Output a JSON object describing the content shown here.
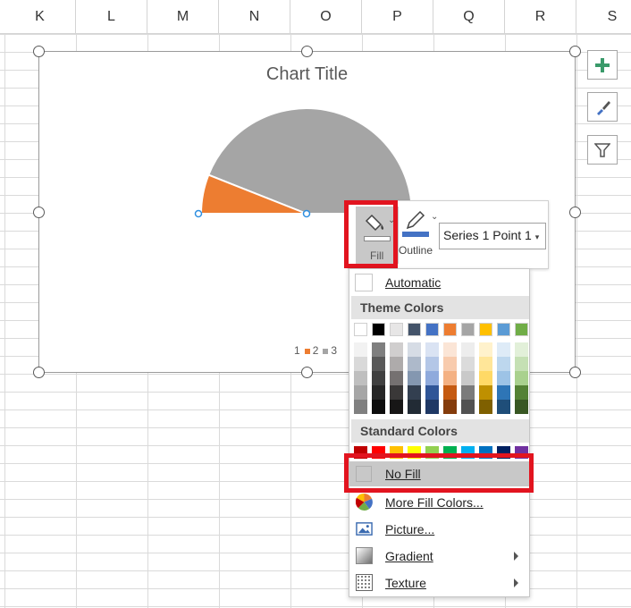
{
  "columns": [
    "K",
    "L",
    "M",
    "N",
    "O",
    "P",
    "Q",
    "R",
    "S"
  ],
  "chart": {
    "title": "Chart Title",
    "legend": [
      {
        "label": "1",
        "color": "#4472c4"
      },
      {
        "label": "2",
        "color": "#ed7d31"
      },
      {
        "label": "3",
        "color": "#a5a5a5"
      }
    ]
  },
  "chart_data": {
    "type": "pie",
    "title": "Chart Title",
    "categories": [
      "1",
      "2",
      "3"
    ],
    "values": [
      0,
      6,
      44
    ],
    "colors": [
      "#4472c4",
      "#ed7d31",
      "#a5a5a5"
    ],
    "legend": "bottom"
  },
  "side_buttons": [
    "plus-icon",
    "brush-icon",
    "filter-icon"
  ],
  "toolbar": {
    "fill_label": "Fill",
    "outline_label": "Outline",
    "series_select": "Series 1 Point 1",
    "fill_color": "#ffffff",
    "outline_color": "#4472c4"
  },
  "menu": {
    "automatic": "Automatic",
    "theme_header": "Theme Colors",
    "theme_top": [
      "#ffffff",
      "#000000",
      "#e7e6e6",
      "#44546a",
      "#4472c4",
      "#ed7d31",
      "#a5a5a5",
      "#ffc000",
      "#5b9bd5",
      "#70ad47"
    ],
    "theme_shades": [
      [
        "#f2f2f2",
        "#d9d9d9",
        "#bfbfbf",
        "#a6a6a6",
        "#808080"
      ],
      [
        "#7f7f7f",
        "#595959",
        "#404040",
        "#262626",
        "#0d0d0d"
      ],
      [
        "#d0cece",
        "#aeabab",
        "#757171",
        "#3a3838",
        "#171616"
      ],
      [
        "#d6dce5",
        "#adb9ca",
        "#8497b0",
        "#333f50",
        "#222b35"
      ],
      [
        "#dae3f3",
        "#b4c7e7",
        "#8faadc",
        "#2f5597",
        "#1f3864"
      ],
      [
        "#fbe5d6",
        "#f8cbad",
        "#f4b183",
        "#c55a11",
        "#843c0c"
      ],
      [
        "#ededed",
        "#dbdbdb",
        "#c9c9c9",
        "#7b7b7b",
        "#525252"
      ],
      [
        "#fff2cc",
        "#ffe699",
        "#ffd966",
        "#bf9000",
        "#7f6000"
      ],
      [
        "#deebf7",
        "#bdd7ee",
        "#9dc3e6",
        "#2e75b6",
        "#1f4e79"
      ],
      [
        "#e2f0d9",
        "#c5e0b4",
        "#a9d18e",
        "#548235",
        "#385723"
      ]
    ],
    "standard_header": "Standard Colors",
    "standard": [
      "#c00000",
      "#ff0000",
      "#ffc000",
      "#ffff00",
      "#92d050",
      "#00b050",
      "#00b0f0",
      "#0070c0",
      "#002060",
      "#7030a0"
    ],
    "no_fill": "No Fill",
    "more_colors": "More Fill Colors...",
    "picture": "Picture...",
    "gradient": "Gradient",
    "texture": "Texture"
  }
}
